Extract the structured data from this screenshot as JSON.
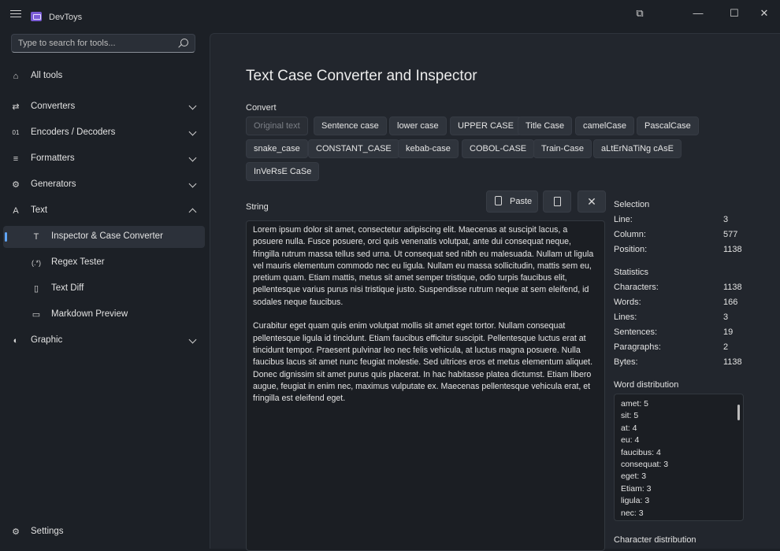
{
  "window": {
    "title": "DevToys",
    "controls": [
      "compact-overlay-icon",
      "minimize-icon",
      "maximize-icon",
      "close-icon"
    ]
  },
  "sidebar": {
    "search_placeholder": "Type to search for tools...",
    "items": [
      {
        "label": "All tools",
        "icon": "home-icon"
      },
      {
        "label": "Converters",
        "icon": "converters-icon"
      },
      {
        "label": "Encoders / Decoders",
        "icon": "encoders-icon"
      },
      {
        "label": "Formatters",
        "icon": "formatters-icon"
      },
      {
        "label": "Generators",
        "icon": "generators-icon"
      },
      {
        "label": "Text",
        "icon": "text-icon"
      },
      {
        "label": "Inspector & Case Converter",
        "icon": "inspector-icon"
      },
      {
        "label": "Regex Tester",
        "icon": "regex-icon"
      },
      {
        "label": "Text Diff",
        "icon": "text-diff-icon"
      },
      {
        "label": "Markdown Preview",
        "icon": "markdown-icon"
      },
      {
        "label": "Graphic",
        "icon": "graphic-icon"
      },
      {
        "label": "Settings",
        "icon": "settings-icon"
      }
    ]
  },
  "main": {
    "title": "Text Case Converter and Inspector",
    "convert_label": "Convert",
    "case_buttons": [
      "Original text",
      "Sentence case",
      "lower case",
      "UPPER CASE",
      "Title Case",
      "camelCase",
      "PascalCase",
      "snake_case",
      "CONSTANT_CASE",
      "kebab-case",
      "COBOL-CASE",
      "Train-Case",
      "aLtErNaTiNg cAsE",
      "InVeRsE CaSe"
    ],
    "string_label": "String",
    "paste_label": "Paste",
    "text": [
      "Lorem ipsum dolor sit amet, consectetur adipiscing elit. Maecenas at suscipit lacus, a posuere nulla. Fusce posuere, orci quis venenatis volutpat, ante dui consequat neque, fringilla rutrum massa tellus sed urna. Ut consequat sed nibh eu malesuada. Nullam ut ligula vel mauris elementum commodo nec eu ligula. Nullam eu massa sollicitudin, mattis sem eu, pretium quam. Etiam mattis, metus sit amet semper tristique, odio turpis faucibus elit, pellentesque varius purus nisi tristique justo. Suspendisse rutrum neque at sem eleifend, id sodales neque faucibus.",
      "Curabitur eget quam quis enim volutpat mollis sit amet eget tortor. Nullam consequat pellentesque ligula id tincidunt. Etiam faucibus efficitur suscipit. Pellentesque luctus erat at tincidunt tempor. Praesent pulvinar leo nec felis vehicula, at luctus magna posuere. Nulla faucibus lacus sit amet nunc feugiat molestie. Sed ultrices eros et metus elementum aliquet. Donec dignissim sit amet purus quis placerat. In hac habitasse platea dictumst. Etiam libero augue, feugiat in enim nec, maximus vulputate ex. Maecenas pellentesque vehicula erat, et fringilla est eleifend eget."
    ]
  },
  "stats": {
    "selection_label": "Selection",
    "selection": [
      {
        "k": "Line:",
        "v": "3"
      },
      {
        "k": "Column:",
        "v": "577"
      },
      {
        "k": "Position:",
        "v": "1138"
      }
    ],
    "statistics_label": "Statistics",
    "statistics": [
      {
        "k": "Characters:",
        "v": "1138"
      },
      {
        "k": "Words:",
        "v": "166"
      },
      {
        "k": "Lines:",
        "v": "3"
      },
      {
        "k": "Sentences:",
        "v": "19"
      },
      {
        "k": "Paragraphs:",
        "v": "2"
      },
      {
        "k": "Bytes:",
        "v": "1138"
      }
    ],
    "word_distribution_label": "Word distribution",
    "word_distribution": [
      "amet: 5",
      "sit: 5",
      "at: 4",
      "eu: 4",
      "faucibus: 4",
      "consequat: 3",
      "eget: 3",
      "Etiam: 3",
      "ligula: 3",
      "nec: 3"
    ],
    "character_distribution_label": "Character distribution"
  }
}
